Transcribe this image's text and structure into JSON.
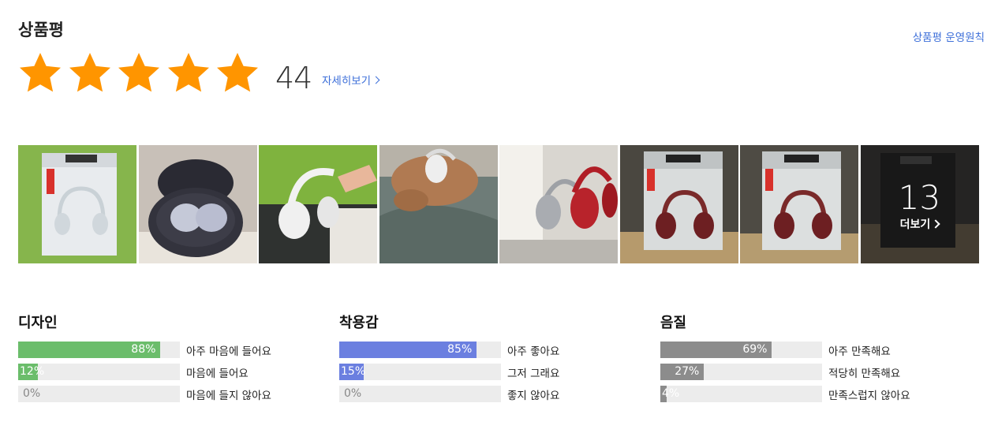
{
  "header": {
    "title": "상품평",
    "policy_link": "상품평 운영원칙"
  },
  "rating": {
    "stars": 5,
    "star_color": "#ff9500",
    "count": "44",
    "detail_link": "자세히보기"
  },
  "photos": {
    "more_count": "13",
    "more_label": "더보기"
  },
  "categories": [
    {
      "title": "디자인",
      "color": "#6bbd6b",
      "rows": [
        {
          "pct_value": 88,
          "pct_label": "88%",
          "label": "아주 마음에 들어요"
        },
        {
          "pct_value": 12,
          "pct_label": "12%",
          "label": "마음에 들어요"
        },
        {
          "pct_value": 0,
          "pct_label": "0%",
          "label": "마음에 들지 않아요"
        }
      ]
    },
    {
      "title": "착용감",
      "color": "#6b7fe0",
      "rows": [
        {
          "pct_value": 85,
          "pct_label": "85%",
          "label": "아주 좋아요"
        },
        {
          "pct_value": 15,
          "pct_label": "15%",
          "label": "그저 그래요"
        },
        {
          "pct_value": 0,
          "pct_label": "0%",
          "label": "좋지 않아요"
        }
      ]
    },
    {
      "title": "음질",
      "color": "#8c8c8c",
      "rows": [
        {
          "pct_value": 69,
          "pct_label": "69%",
          "label": "아주 만족해요"
        },
        {
          "pct_value": 27,
          "pct_label": "27%",
          "label": "적당히 만족해요"
        },
        {
          "pct_value": 4,
          "pct_label": "4%",
          "label": "만족스럽지 않아요"
        }
      ]
    }
  ]
}
